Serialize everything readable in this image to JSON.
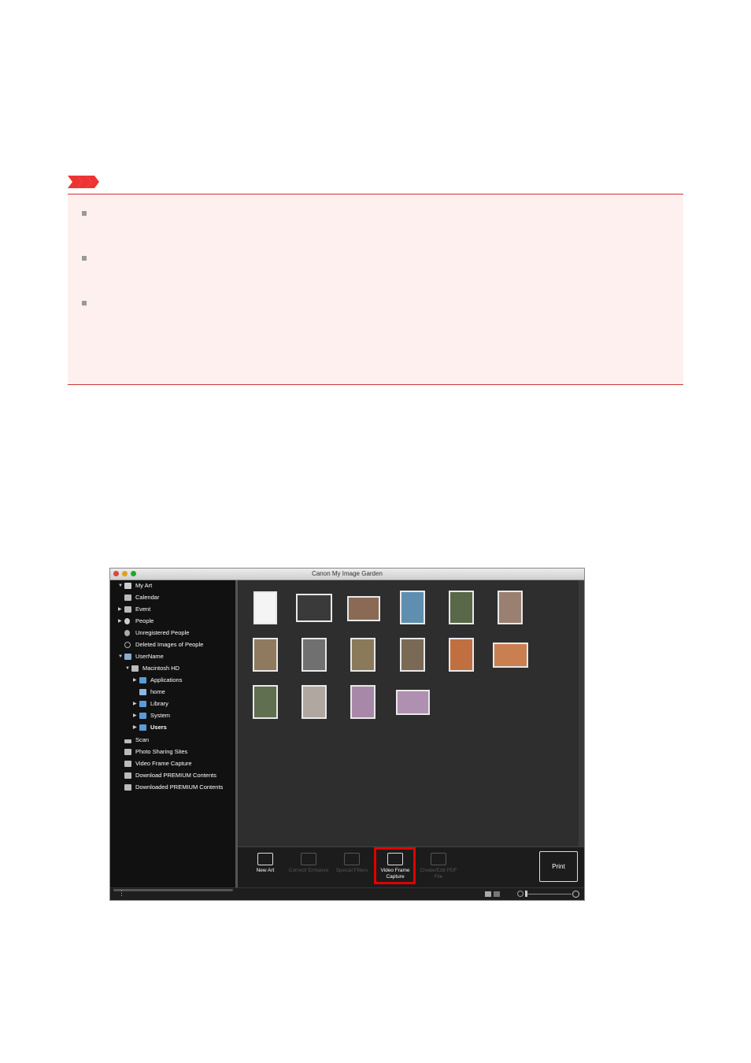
{
  "window": {
    "title": "Canon My Image Garden"
  },
  "sidebar": {
    "items": [
      {
        "label": "My Art",
        "icon": "my-art-icon",
        "arrow": "▼",
        "bold": false
      },
      {
        "label": "Calendar",
        "icon": "calendar-icon",
        "arrow": "",
        "bold": false
      },
      {
        "label": "Event",
        "icon": "event-icon",
        "arrow": "▶",
        "bold": false
      },
      {
        "label": "People",
        "icon": "people-icon",
        "arrow": "▶",
        "bold": false
      },
      {
        "label": "Unregistered People",
        "icon": "unregistered-people-icon",
        "arrow": "",
        "bold": false
      },
      {
        "label": "Deleted Images of People",
        "icon": "deleted-people-icon",
        "arrow": "",
        "bold": false
      },
      {
        "label": "UserName",
        "icon": "computer-icon",
        "arrow": "▼",
        "bold": false
      },
      {
        "label": "Macintosh HD",
        "icon": "hard-drive-icon",
        "arrow": "▼",
        "bold": false
      },
      {
        "label": "Applications",
        "icon": "folder-icon",
        "arrow": "▶",
        "bold": false
      },
      {
        "label": "home",
        "icon": "home-icon",
        "arrow": "",
        "bold": false
      },
      {
        "label": "Library",
        "icon": "folder-icon",
        "arrow": "▶",
        "bold": false
      },
      {
        "label": "System",
        "icon": "folder-icon",
        "arrow": "▶",
        "bold": false
      },
      {
        "label": "Users",
        "icon": "folder-icon",
        "arrow": "▶",
        "bold": true
      },
      {
        "label": "Scan",
        "icon": "scan-icon",
        "arrow": "",
        "bold": false
      },
      {
        "label": "Photo Sharing Sites",
        "icon": "photo-sharing-icon",
        "arrow": "",
        "bold": false
      },
      {
        "label": "Video Frame Capture",
        "icon": "video-frame-icon",
        "arrow": "",
        "bold": false
      },
      {
        "label": "Download PREMIUM Contents",
        "icon": "download-icon",
        "arrow": "",
        "bold": false
      },
      {
        "label": "Downloaded PREMIUM Contents",
        "icon": "downloaded-icon",
        "arrow": "",
        "bold": false
      }
    ]
  },
  "toolbar": {
    "new_art": "New Art",
    "correct_enhance": "Correct/ Enhance",
    "special_filters": "Special Filters",
    "video_frame_capture": "Video Frame Capture",
    "create_edit_pdf": "Create/Edit PDF File",
    "print": "Print"
  },
  "colors": {
    "highlight": "#e00000",
    "important_bg": "#fff0f0",
    "important_rule": "#cc3333"
  }
}
